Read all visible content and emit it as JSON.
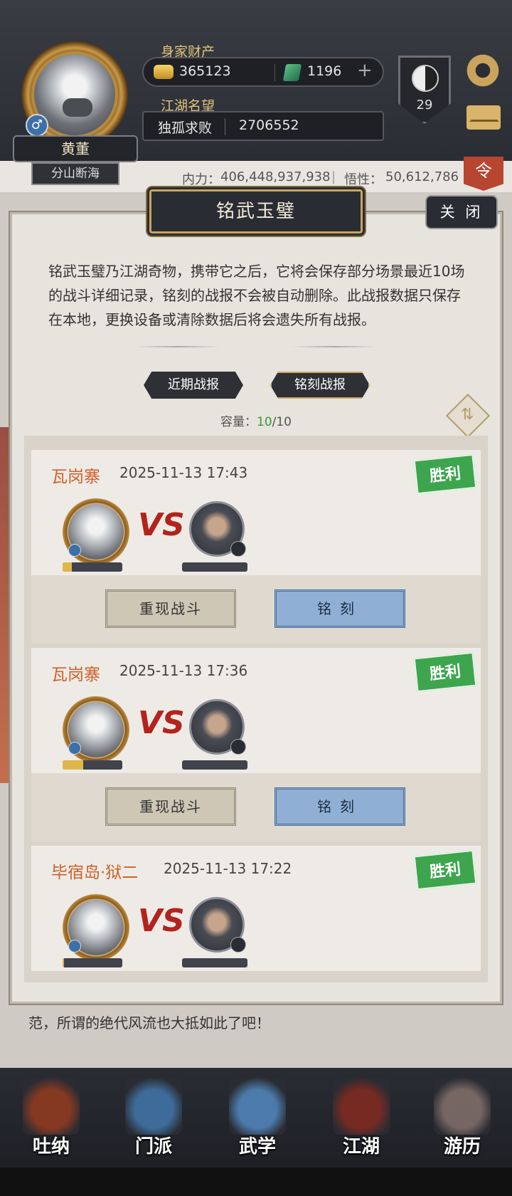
{
  "player": {
    "name": "黄董",
    "title": "分山断海",
    "gender_icon": "male-icon",
    "wealth_label": "身家财产",
    "coins": "365123",
    "jade": "1196",
    "fame_label": "江湖名望",
    "fame_title": "独孤求败",
    "fame_value": "2706552",
    "level": "29"
  },
  "stats": {
    "neili_label": "内力：",
    "neili_value": "406,448,937,938",
    "wuxing_label": "悟性：",
    "wuxing_value": "50,612,786",
    "red_tab": "令"
  },
  "modal": {
    "title": "铭武玉璧",
    "close": "关 闭",
    "description": "铭武玉璧乃江湖奇物，携带它之后，它将会保存部分场景最近10场的战斗详细记录，铭刻的战报不会被自动删除。此战报数据只保存在本地，更换设备或清除数据后将会遗失所有战报。",
    "tabs": [
      "近期战报",
      "铭刻战报"
    ],
    "capacity_label": "容量：",
    "capacity_used": "10",
    "capacity_total": "/10"
  },
  "battles": [
    {
      "place": "瓦岗寨",
      "time": "2025-11-13 17:43",
      "result": "胜利",
      "vs": "VS",
      "replay": "重现战斗",
      "engrave": "铭刻",
      "my_hp": 0.15
    },
    {
      "place": "瓦岗寨",
      "time": "2025-11-13 17:36",
      "result": "胜利",
      "vs": "VS",
      "replay": "重现战斗",
      "engrave": "铭刻",
      "my_hp": 0.35
    },
    {
      "place": "毕宿岛·狱二",
      "time": "2025-11-13 17:22",
      "result": "胜利",
      "vs": "VS",
      "my_hp": 0.02
    }
  ],
  "scene": {
    "story": "范，所谓的绝代风流也大抵如此了吧！"
  },
  "nav": [
    {
      "label": "吐纳",
      "icon": "meditation-icon",
      "color": "#8a3a22"
    },
    {
      "label": "门派",
      "icon": "sect-icon",
      "color": "#3f6fa0"
    },
    {
      "label": "武学",
      "icon": "martial-arts-icon",
      "color": "#4e7fb2"
    },
    {
      "label": "江湖",
      "icon": "jianghu-icon",
      "color": "#7a2a22"
    },
    {
      "label": "游历",
      "icon": "travel-icon",
      "color": "#7a6a66"
    }
  ]
}
